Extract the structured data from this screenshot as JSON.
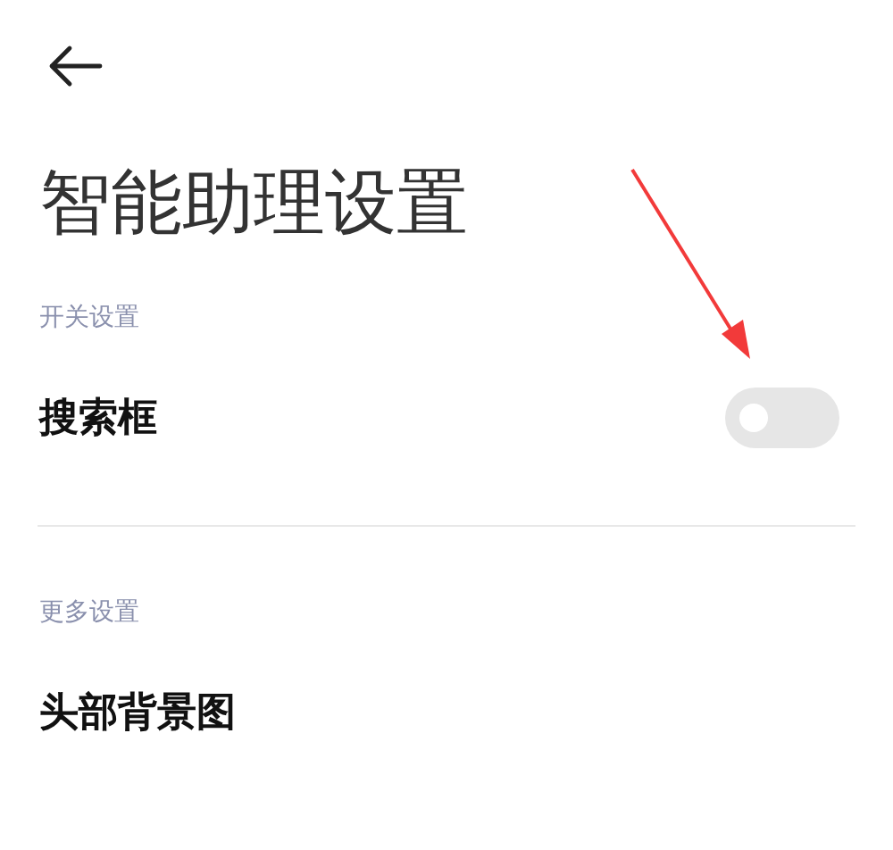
{
  "title": "智能助理设置",
  "sections": [
    {
      "header": "开关设置",
      "items": [
        {
          "kind": "switch",
          "label": "搜索框",
          "on": false
        }
      ]
    },
    {
      "header": "更多设置",
      "items": [
        {
          "kind": "link",
          "label": "头部背景图"
        }
      ]
    }
  ]
}
